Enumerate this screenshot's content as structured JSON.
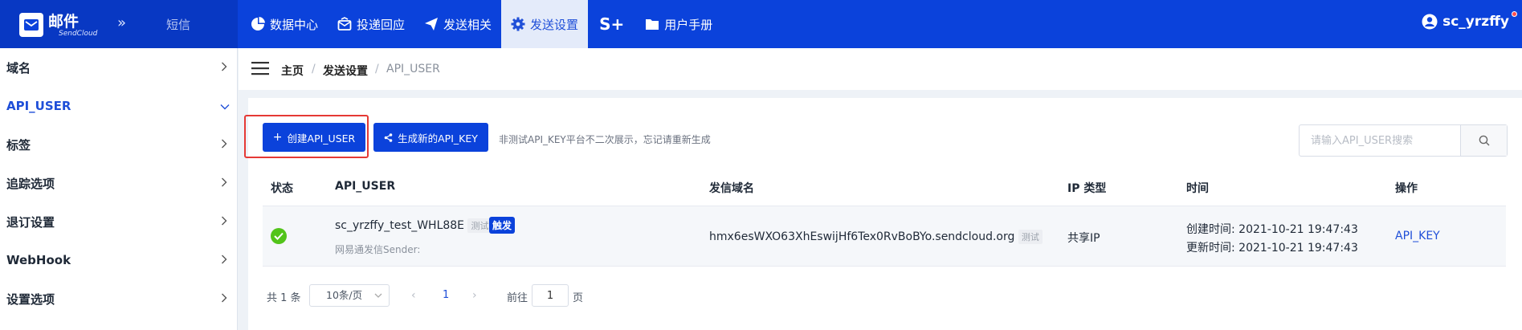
{
  "brand": {
    "name": "邮件",
    "sub": "SendCloud",
    "collapse": "»",
    "sms": "短信"
  },
  "nav": [
    {
      "label": "数据中心",
      "icon": "pie-chart-icon"
    },
    {
      "label": "投递回应",
      "icon": "inbox-icon"
    },
    {
      "label": "发送相关",
      "icon": "paper-plane-icon"
    },
    {
      "label": "发送设置",
      "icon": "gear-icon",
      "active": true
    },
    {
      "label": "S+",
      "icon": "s-plus-icon"
    },
    {
      "label": "用户手册",
      "icon": "folder-icon"
    }
  ],
  "user": {
    "name": "sc_yrzffy"
  },
  "sidebar": {
    "items": [
      {
        "label": "域名"
      },
      {
        "label": "API_USER",
        "active": true
      },
      {
        "label": "标签"
      },
      {
        "label": "追踪选项"
      },
      {
        "label": "退订设置"
      },
      {
        "label": "WebHook"
      },
      {
        "label": "设置选项"
      }
    ]
  },
  "breadcrumb": {
    "home": "主页",
    "section": "发送设置",
    "current": "API_USER",
    "sep": "/"
  },
  "toolbar": {
    "create_label": "创建API_USER",
    "create_icon": "+",
    "generate_label": "生成新的API_KEY",
    "hint": "非测试API_KEY平台不二次展示，忘记请重新生成",
    "search_placeholder": "请输入API_USER搜索"
  },
  "table": {
    "headers": [
      "状态",
      "API_USER",
      "发信域名",
      "IP 类型",
      "时间",
      "操作"
    ],
    "rows": [
      {
        "status": "ok",
        "api_user": "sc_yrzffy_test_WHL88E",
        "api_user_tag": "测试",
        "api_user_type": "触发",
        "sender_note": "网易通发信Sender:",
        "domain": "hmx6esWXO63XhEswijHf6Tex0RvBoBYo.sendcloud.org",
        "domain_tag": "测试",
        "ip_type": "共享IP",
        "created": "创建时间: 2021-10-21 19:47:43",
        "updated": "更新时间: 2021-10-21 19:47:43",
        "action": "API_KEY"
      }
    ]
  },
  "pagination": {
    "total": "共 1 条",
    "page_size": "10条/页",
    "prev": "‹",
    "page": "1",
    "next": "›",
    "goto": "前往",
    "goto_value": "1",
    "page_unit": "页"
  },
  "colors": {
    "primary": "#0b42db",
    "success": "#52c41a",
    "highlight": "#e53935"
  }
}
